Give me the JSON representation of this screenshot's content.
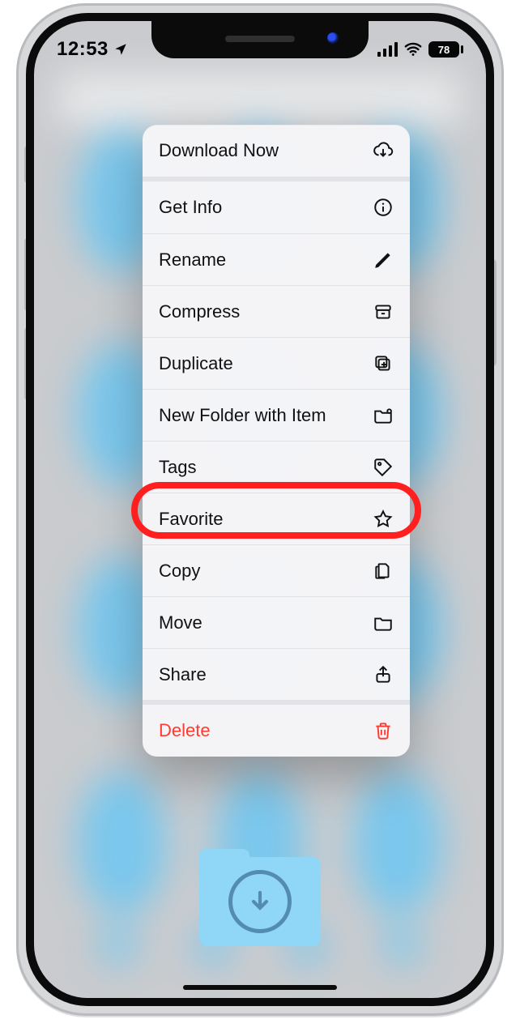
{
  "status": {
    "time": "12:53",
    "battery_percent": "78"
  },
  "menu": {
    "groups": [
      {
        "items": [
          {
            "label": "Download Now",
            "icon": "download-cloud"
          }
        ]
      },
      {
        "items": [
          {
            "label": "Get Info",
            "icon": "info"
          },
          {
            "label": "Rename",
            "icon": "pencil"
          },
          {
            "label": "Compress",
            "icon": "archive"
          },
          {
            "label": "Duplicate",
            "icon": "duplicate"
          },
          {
            "label": "New Folder with Item",
            "icon": "new-folder"
          },
          {
            "label": "Tags",
            "icon": "tag"
          },
          {
            "label": "Favorite",
            "icon": "star",
            "highlighted": true
          },
          {
            "label": "Copy",
            "icon": "copy"
          },
          {
            "label": "Move",
            "icon": "folder"
          },
          {
            "label": "Share",
            "icon": "share"
          }
        ]
      },
      {
        "items": [
          {
            "label": "Delete",
            "icon": "trash",
            "destructive": true
          }
        ]
      }
    ]
  },
  "colors": {
    "destructive": "#ff3b30",
    "highlight": "#ff1f1f",
    "folder": "#8fd6f7"
  },
  "annotation": {
    "highlights": [
      "Favorite"
    ]
  }
}
